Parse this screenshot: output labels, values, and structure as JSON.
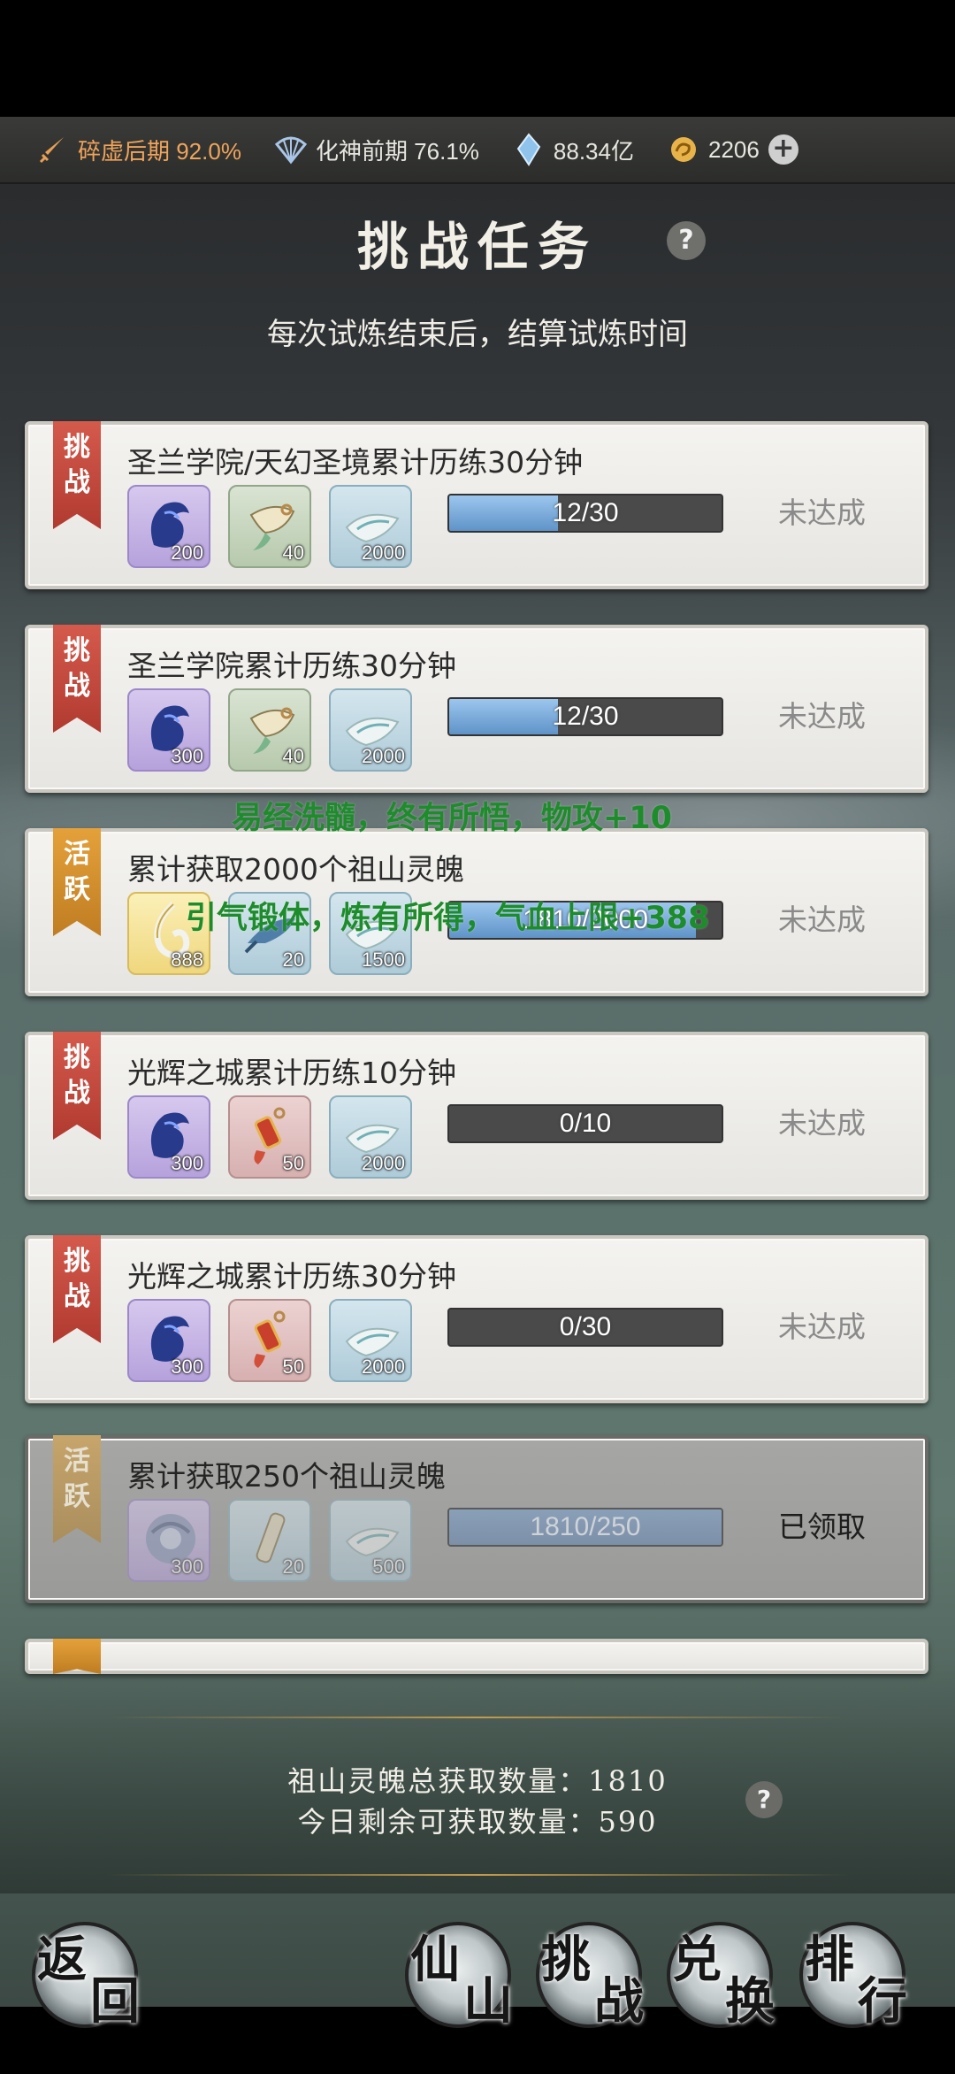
{
  "status_bar": {
    "realm1": "碎虚后期 92.0%",
    "realm2": "化神前期 76.1%",
    "spirit_stones": "88.34亿",
    "currency": "2206"
  },
  "header": {
    "title": "挑战任务",
    "subtitle": "每次试炼结束后，结算试炼时间",
    "help": "?"
  },
  "tasks": [
    {
      "tag": [
        "挑",
        "战"
      ],
      "tag_color": "red",
      "title": "圣兰学院/天幻圣境累计历练30分钟",
      "rewards": [
        {
          "icon": "blue-dragon-icon",
          "count": "200"
        },
        {
          "icon": "fish-pendant-icon",
          "count": "40"
        },
        {
          "icon": "jade-cloth-icon",
          "count": "2000"
        }
      ],
      "progress_text": "12/30",
      "progress": 0.4,
      "status": "未达成",
      "done": false
    },
    {
      "tag": [
        "挑",
        "战"
      ],
      "tag_color": "red",
      "title": "圣兰学院累计历练30分钟",
      "rewards": [
        {
          "icon": "blue-dragon-icon",
          "count": "300"
        },
        {
          "icon": "fish-pendant-icon",
          "count": "40"
        },
        {
          "icon": "jade-cloth-icon",
          "count": "2000"
        }
      ],
      "progress_text": "12/30",
      "progress": 0.4,
      "status": "未达成",
      "done": false
    },
    {
      "tag": [
        "活",
        "跃"
      ],
      "tag_color": "gold",
      "title": "累计获取2000个祖山灵魄",
      "rewards": [
        {
          "icon": "gold-swirl-icon",
          "count": "888"
        },
        {
          "icon": "blue-fish-icon",
          "count": "20"
        },
        {
          "icon": "jade-cloth-icon",
          "count": "1500"
        }
      ],
      "progress_text": "1810/2000",
      "progress": 0.905,
      "status": "未达成",
      "done": false
    },
    {
      "tag": [
        "挑",
        "战"
      ],
      "tag_color": "red",
      "title": "光辉之城累计历练10分钟",
      "rewards": [
        {
          "icon": "blue-dragon-icon",
          "count": "300"
        },
        {
          "icon": "red-charm-icon",
          "count": "50"
        },
        {
          "icon": "jade-cloth-icon",
          "count": "2000"
        }
      ],
      "progress_text": "0/10",
      "progress": 0,
      "status": "未达成",
      "done": false
    },
    {
      "tag": [
        "挑",
        "战"
      ],
      "tag_color": "red",
      "title": "光辉之城累计历练30分钟",
      "rewards": [
        {
          "icon": "blue-dragon-icon",
          "count": "300"
        },
        {
          "icon": "red-charm-icon",
          "count": "50"
        },
        {
          "icon": "jade-cloth-icon",
          "count": "2000"
        }
      ],
      "progress_text": "0/30",
      "progress": 0,
      "status": "未达成",
      "done": false
    },
    {
      "tag": [
        "活",
        "跃"
      ],
      "tag_color": "gold",
      "title": "累计获取250个祖山灵魄",
      "rewards": [
        {
          "icon": "spirit-ring-icon",
          "count": "300"
        },
        {
          "icon": "scroll-icon",
          "count": "20"
        },
        {
          "icon": "jade-cloth-icon",
          "count": "500"
        }
      ],
      "progress_text": "1810/250",
      "progress": 1,
      "status": "已领取",
      "done": true
    }
  ],
  "floating_texts": [
    "易经洗髓，终有所悟，物攻+10",
    "引气锻体，炼有所得，气血上限+388"
  ],
  "footer": {
    "total_label": "祖山灵魄总获取数量：1810",
    "remaining_label": "今日剩余可获取数量：590"
  },
  "nav": {
    "back": [
      "返",
      "回"
    ],
    "xianshan": [
      "仙",
      "山"
    ],
    "challenge": [
      "挑",
      "战"
    ],
    "exchange": [
      "兑",
      "换"
    ],
    "ranking": [
      "排",
      "行"
    ]
  },
  "colors": {
    "progress_fill": "#6fa3d6",
    "tag_red": "#c2473b",
    "tag_gold": "#d4912d",
    "float_text": "#1d8c2a"
  }
}
